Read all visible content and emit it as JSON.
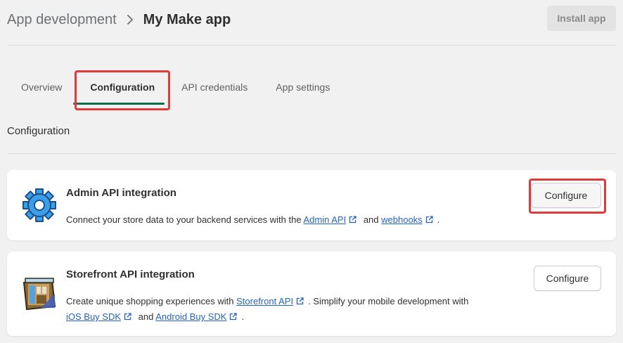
{
  "breadcrumb": {
    "parent": "App development",
    "current": "My Make app"
  },
  "header": {
    "install_button": "Install app"
  },
  "tabs": [
    {
      "label": "Overview"
    },
    {
      "label": "Configuration"
    },
    {
      "label": "API credentials"
    },
    {
      "label": "App settings"
    }
  ],
  "section_title": "Configuration",
  "cards": [
    {
      "title": "Admin API integration",
      "desc_prefix": "Connect your store data to your backend services with the",
      "link1": "Admin API",
      "desc_and": "and",
      "link2": "webhooks",
      "desc_suffix": ".",
      "button": "Configure"
    },
    {
      "title": "Storefront API integration",
      "desc_prefix": "Create unique shopping experiences with",
      "link1": "Storefront API",
      "desc_mid": ". Simplify your mobile development with",
      "link2": "iOS Buy SDK",
      "desc_and": "and",
      "link3": "Android Buy SDK",
      "desc_suffix": ".",
      "button": "Configure"
    }
  ],
  "colors": {
    "accent_green": "#0b6e4f",
    "highlight_red": "#e03a3a",
    "link_blue": "#2463bc"
  },
  "icons": [
    "chevron-right-icon",
    "gear-icon",
    "storefront-icon",
    "external-link-icon"
  ]
}
